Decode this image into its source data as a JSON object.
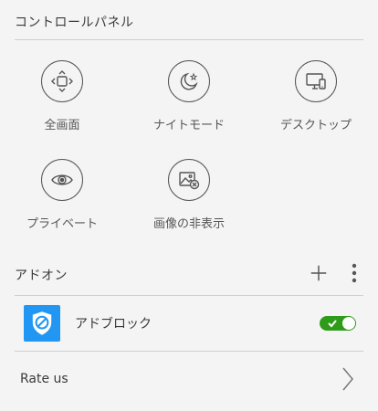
{
  "control_panel": {
    "title": "コントロールパネル",
    "tiles": [
      {
        "label": "全画面",
        "icon": "fullscreen-icon"
      },
      {
        "label": "ナイトモード",
        "icon": "night-mode-icon"
      },
      {
        "label": "デスクトップ",
        "icon": "desktop-icon"
      },
      {
        "label": "プライベート",
        "icon": "private-eye-icon"
      },
      {
        "label": "画像の非表示",
        "icon": "hide-images-icon"
      }
    ]
  },
  "addons": {
    "title": "アドオン",
    "add_icon": "plus-icon",
    "menu_icon": "more-vertical-icon",
    "items": [
      {
        "label": "アドブロック",
        "icon": "adblock-shield-icon",
        "enabled": true
      }
    ]
  },
  "rate": {
    "label": "Rate us",
    "icon": "chevron-right-icon"
  },
  "colors": {
    "toggle_on": "#2f9b1a",
    "addon_icon_bg": "#2196f3",
    "background": "#f4f4f4"
  }
}
